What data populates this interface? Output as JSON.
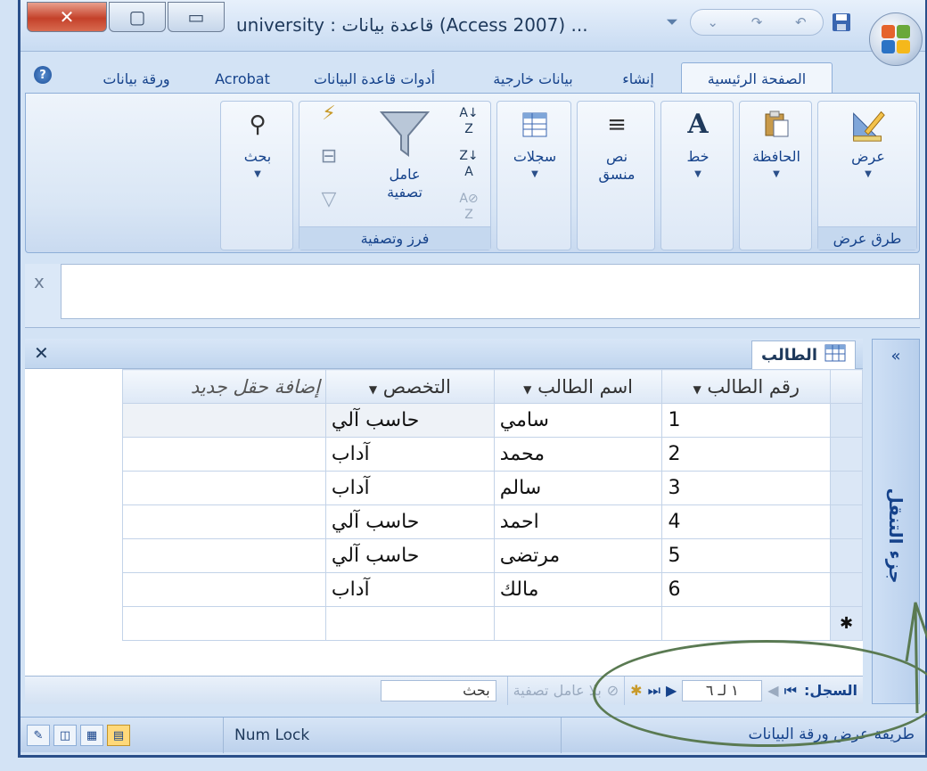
{
  "window": {
    "title": "university : قاعدة بيانات (Access 2007) ...",
    "close_glyph": "✕",
    "max_glyph": "▢",
    "min_glyph": "▭"
  },
  "ribbon_tabs": [
    "الصفحة الرئيسية",
    "إنشاء",
    "بيانات خارجية",
    "أدوات قاعدة البيانات",
    "Acrobat",
    "ورقة بيانات"
  ],
  "help_glyph": "?",
  "ribbon": {
    "views_group": {
      "label": "طرق عرض",
      "view_button": "عرض"
    },
    "clipboard": "الحافظة",
    "font": "خط",
    "rich_text": "نص منسق",
    "records": "سجلات",
    "sort_filter_group": "فرز وتصفية",
    "filter": "عامل تصفية",
    "find": "بحث"
  },
  "formula_close": "x",
  "datasheet": {
    "close_glyph": "✕",
    "tab_label": "الطالب",
    "columns": [
      "رقم الطالب",
      "اسم الطالب",
      "التخصص",
      "إضافة حقل جديد"
    ],
    "rows": [
      [
        "1",
        "سامي",
        "حاسب آلي"
      ],
      [
        "2",
        "محمد",
        "آداب"
      ],
      [
        "3",
        "سالم",
        "آداب"
      ],
      [
        "4",
        "احمد",
        "حاسب آلي"
      ],
      [
        "5",
        "مرتضى",
        "حاسب آلي"
      ],
      [
        "6",
        "مالك",
        "آداب"
      ]
    ],
    "new_row_marker": "✱"
  },
  "nav_pane": {
    "label": "جزء التنقل",
    "chevron": "«"
  },
  "record_nav": {
    "label": "السجل:",
    "value": "١ لـ ٦",
    "no_filter": "بلا عامل تصفية",
    "search": "بحث"
  },
  "status": {
    "view_name": "طريقة عرض ورقة البيانات",
    "num_lock": "Num Lock"
  },
  "colors": {
    "accent": "#15428b",
    "ribbon_bg": "#d9e6f5",
    "annotation": "#5a7a52"
  }
}
